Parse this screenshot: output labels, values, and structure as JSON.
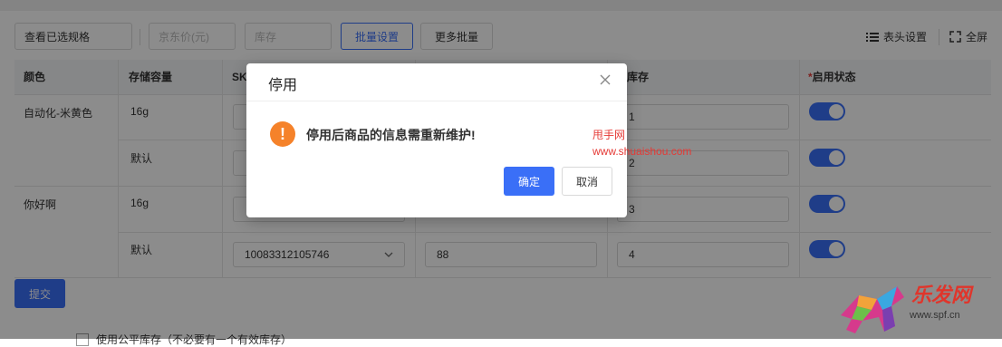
{
  "toolbar": {
    "view_selected_btn": "查看已选规格",
    "jd_price_placeholder": "京东价(元)",
    "stock_placeholder": "库存",
    "batch_settings_btn": "批量设置",
    "more_batch_btn": "更多批量",
    "header_settings_label": "表头设置",
    "fullscreen_label": "全屏"
  },
  "table": {
    "headers": {
      "color": "颜色",
      "storage": "存储容量",
      "sku": "SK",
      "stock": "库存",
      "status_required": "*",
      "status": "启用状态"
    },
    "rows": [
      {
        "color": "自动化-米黄色",
        "storage": "16g",
        "sku": "",
        "price": "",
        "stock": "1"
      },
      {
        "color": "",
        "storage": "默认",
        "sku": "",
        "price": "",
        "stock": "2"
      },
      {
        "color": "你好啊",
        "storage": "16g",
        "sku": "",
        "price": "",
        "stock": "3"
      },
      {
        "color": "",
        "storage": "默认",
        "sku": "10083312105746",
        "price": "88",
        "stock": "4"
      }
    ]
  },
  "submit_label": "提交",
  "bottom_option": "使用公平库存（不必要有一个有效库存）",
  "modal": {
    "title": "停用",
    "message": "停用后商品的信息需重新维护!",
    "ok_label": "确定",
    "cancel_label": "取消"
  },
  "watermark": {
    "line1": "甩手网",
    "line2": "www.shuaishou.com"
  },
  "logo": {
    "text": "乐发网",
    "url": "www.spf.cn"
  },
  "colors": {
    "accent": "#3a6ff7",
    "warning": "#f5822a",
    "watermark": "#e53935"
  }
}
